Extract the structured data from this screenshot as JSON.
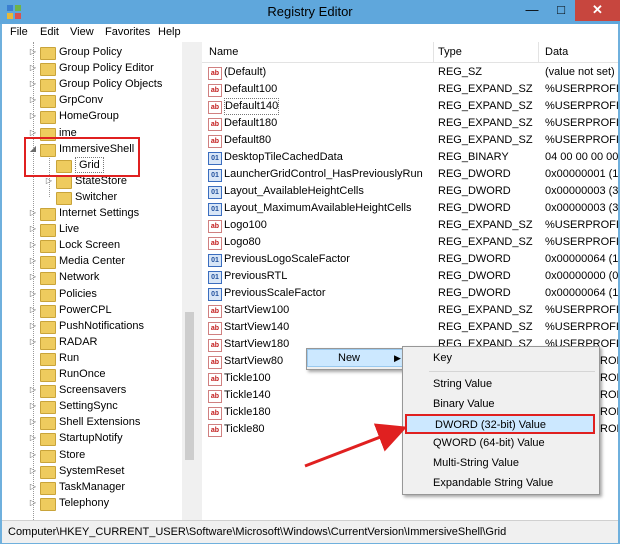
{
  "window": {
    "title": "Registry Editor"
  },
  "menubar": [
    "File",
    "Edit",
    "View",
    "Favorites",
    "Help"
  ],
  "tree": [
    {
      "label": "Group Policy",
      "expanded": false
    },
    {
      "label": "Group Policy Editor",
      "expanded": false
    },
    {
      "label": "Group Policy Objects",
      "expanded": false
    },
    {
      "label": "GrpConv",
      "expanded": false
    },
    {
      "label": "HomeGroup",
      "expanded": false
    },
    {
      "label": "ime",
      "expanded": false
    },
    {
      "label": "ImmersiveShell",
      "expanded": true
    },
    {
      "label": "Grid",
      "selected": true
    },
    {
      "label": "StateStore",
      "expanded": false
    },
    {
      "label": "Switcher"
    },
    {
      "label": "Internet Settings",
      "expanded": false
    },
    {
      "label": "Live",
      "expanded": false
    },
    {
      "label": "Lock Screen",
      "expanded": false
    },
    {
      "label": "Media Center",
      "expanded": false
    },
    {
      "label": "Network",
      "expanded": false
    },
    {
      "label": "Policies",
      "expanded": false
    },
    {
      "label": "PowerCPL",
      "expanded": false
    },
    {
      "label": "PushNotifications",
      "expanded": false
    },
    {
      "label": "RADAR",
      "expanded": false
    },
    {
      "label": "Run"
    },
    {
      "label": "RunOnce"
    },
    {
      "label": "Screensavers",
      "expanded": false
    },
    {
      "label": "SettingSync",
      "expanded": false
    },
    {
      "label": "Shell Extensions",
      "expanded": false
    },
    {
      "label": "StartupNotify",
      "expanded": false
    },
    {
      "label": "Store",
      "expanded": false
    },
    {
      "label": "SystemReset",
      "expanded": false
    },
    {
      "label": "TaskManager",
      "expanded": false
    },
    {
      "label": "Telephony",
      "expanded": false
    }
  ],
  "list": {
    "headers": {
      "name": "Name",
      "type": "Type",
      "data": "Data"
    },
    "rows": [
      {
        "name": "(Default)",
        "type": "REG_SZ",
        "data": "(value not set)",
        "icon": "string-value-icon"
      },
      {
        "name": "Default100",
        "type": "REG_EXPAND_SZ",
        "data": "%USERPROFILE",
        "icon": "string-value-icon"
      },
      {
        "name": "Default140",
        "type": "REG_EXPAND_SZ",
        "data": "%USERPROFILE",
        "icon": "string-value-icon"
      },
      {
        "name": "Default180",
        "type": "REG_EXPAND_SZ",
        "data": "%USERPROFILE",
        "icon": "string-value-icon"
      },
      {
        "name": "Default80",
        "type": "REG_EXPAND_SZ",
        "data": "%USERPROFILE",
        "icon": "string-value-icon"
      },
      {
        "name": "DesktopTileCachedData",
        "type": "REG_BINARY",
        "data": "04 00 00 00 00 0",
        "icon": "binary-value-icon"
      },
      {
        "name": "LauncherGridControl_HasPreviouslyRun",
        "type": "REG_DWORD",
        "data": "0x00000001 (1)",
        "icon": "binary-value-icon"
      },
      {
        "name": "Layout_AvailableHeightCells",
        "type": "REG_DWORD",
        "data": "0x00000003 (3)",
        "icon": "binary-value-icon"
      },
      {
        "name": "Layout_MaximumAvailableHeightCells",
        "type": "REG_DWORD",
        "data": "0x00000003 (3)",
        "icon": "binary-value-icon"
      },
      {
        "name": "Logo100",
        "type": "REG_EXPAND_SZ",
        "data": "%USERPROFILE",
        "icon": "string-value-icon"
      },
      {
        "name": "Logo80",
        "type": "REG_EXPAND_SZ",
        "data": "%USERPROFILE",
        "icon": "string-value-icon"
      },
      {
        "name": "PreviousLogoScaleFactor",
        "type": "REG_DWORD",
        "data": "0x00000064 (100",
        "icon": "binary-value-icon"
      },
      {
        "name": "PreviousRTL",
        "type": "REG_DWORD",
        "data": "0x00000000 (0)",
        "icon": "binary-value-icon"
      },
      {
        "name": "PreviousScaleFactor",
        "type": "REG_DWORD",
        "data": "0x00000064 (100",
        "icon": "binary-value-icon"
      },
      {
        "name": "StartView100",
        "type": "REG_EXPAND_SZ",
        "data": "%USERPROFILE",
        "icon": "string-value-icon"
      },
      {
        "name": "StartView140",
        "type": "REG_EXPAND_SZ",
        "data": "%USERPROFILE",
        "icon": "string-value-icon"
      },
      {
        "name": "StartView180",
        "type": "REG_EXPAND_SZ",
        "data": "%USERPROFILE",
        "icon": "string-value-icon"
      },
      {
        "name": "StartView80",
        "type": "",
        "data": "ROFILE",
        "icon": "string-value-icon"
      },
      {
        "name": "Tickle100",
        "type": "",
        "data": "ROFILE",
        "icon": "string-value-icon"
      },
      {
        "name": "Tickle140",
        "type": "",
        "data": "ROFILE",
        "icon": "string-value-icon"
      },
      {
        "name": "Tickle180",
        "type": "",
        "data": "ROFILE",
        "icon": "string-value-icon"
      },
      {
        "name": "Tickle80",
        "type": "",
        "data": "ROFILE",
        "icon": "string-value-icon"
      }
    ]
  },
  "context_menu": {
    "new_label": "New",
    "submenu": [
      "Key",
      "String Value",
      "Binary Value",
      "DWORD (32-bit) Value",
      "QWORD (64-bit) Value",
      "Multi-String Value",
      "Expandable String Value"
    ],
    "highlighted": "DWORD (32-bit) Value"
  },
  "statusbar": {
    "path": "Computer\\HKEY_CURRENT_USER\\Software\\Microsoft\\Windows\\CurrentVersion\\ImmersiveShell\\Grid"
  },
  "colors": {
    "title_bar": "#5fa7dc",
    "close": "#c7463e",
    "highlight_annotation": "#e02020",
    "selection": "#cce8ff"
  }
}
